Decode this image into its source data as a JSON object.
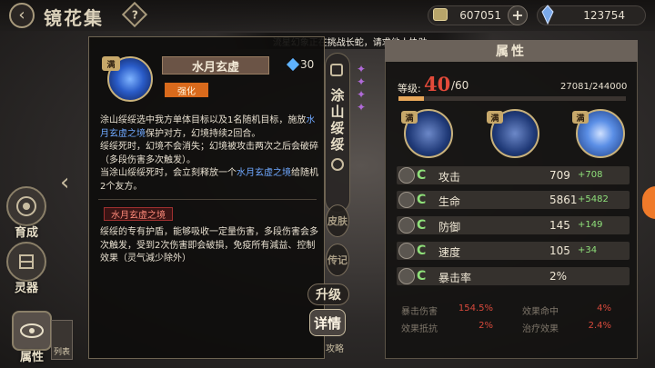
{
  "header": {
    "title": "镜花集",
    "back_glyph": "‹",
    "help_glyph": "?"
  },
  "currency": {
    "gold": "607051",
    "plus_glyph": "+",
    "gems": "123754"
  },
  "banner": "流星幻象正在挑战长蛇，请求他人协助~",
  "nav": {
    "grow": "育成",
    "weapon": "灵器",
    "attr": "属性",
    "list": "列表"
  },
  "skill": {
    "max_tag": "满",
    "name": "水月玄虚",
    "cost": "30",
    "strengthen_label": "强化",
    "desc_parts": [
      "涂山绥绥选中我方单体目标以及1名随机目标，施放",
      "水月玄虚之境",
      "保护对方，幻境持续2回合。"
    ],
    "desc_line2": "绥绥死时，幻境不会消失；幻境被攻击两次之后会破碎（多段伤害多次触发）。",
    "desc_parts3": [
      "当涂山绥绥死时，会立刻释放一个",
      "水月玄虚之境",
      "给随机2个友方。"
    ],
    "sub_title": "水月玄虚之境",
    "sub_desc": "绥绥的专有护盾，能够吸收一定量伤害，多段伤害会多次触发，受到2次伤害即会破損，免疫所有減益、控制效果（灵气減少除外）"
  },
  "side": {
    "name": "涂山绥绥",
    "skin": "皮肤",
    "bio": "传记",
    "upgrade": "升级",
    "detail": "详情",
    "guide": "攻略",
    "butterfly_glyph": "✦"
  },
  "attr": {
    "header": "属性",
    "level_label": "等级:",
    "level": "40",
    "level_max": "/60",
    "exp": "27081/244000",
    "exp_fraction": 0.111,
    "max_tag": "满",
    "stat_letter": "C",
    "stats": [
      {
        "name": "攻击",
        "value": "709",
        "bonus": "+708"
      },
      {
        "name": "生命",
        "value": "5861",
        "bonus": "+5482"
      },
      {
        "name": "防御",
        "value": "145",
        "bonus": "+149"
      },
      {
        "name": "速度",
        "value": "105",
        "bonus": "+34"
      },
      {
        "name": "暴击率",
        "value": "2%",
        "bonus": ""
      }
    ],
    "sub": [
      {
        "name": "暴击伤害",
        "value": "154.5%"
      },
      {
        "name": "效果命中",
        "value": "4%"
      },
      {
        "name": "效果抵抗",
        "value": "2%"
      },
      {
        "name": "治疗效果",
        "value": "2.4%"
      }
    ]
  }
}
